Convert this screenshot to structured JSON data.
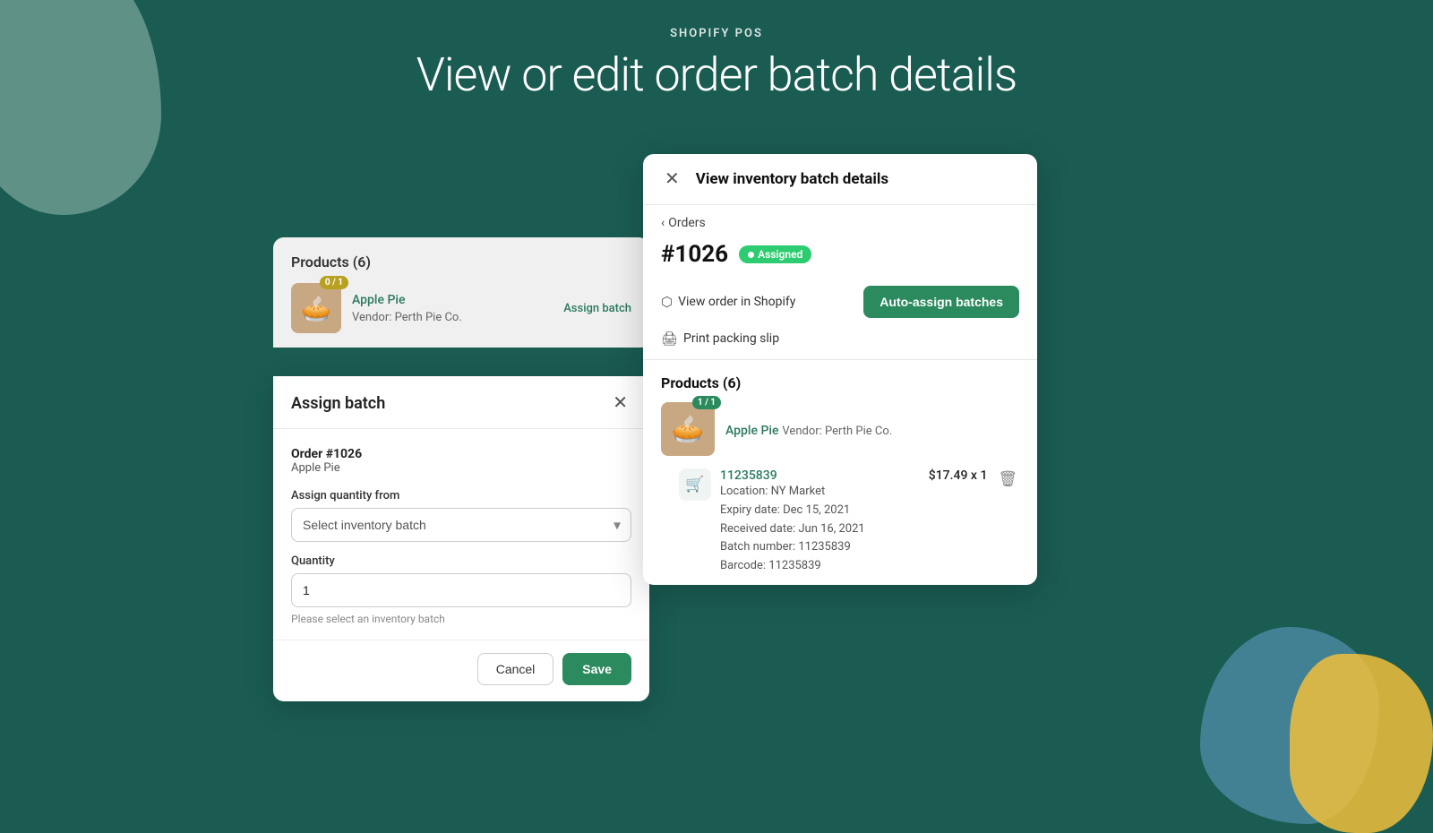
{
  "app": {
    "subtitle": "SHOPIFY POS",
    "title": "View or edit order batch details"
  },
  "products_panel": {
    "header": "Products (6)",
    "product": {
      "badge": "0 / 1",
      "name": "Apple Pie",
      "vendor": "Vendor: Perth Pie Co.",
      "assign_label": "Assign batch"
    }
  },
  "assign_modal": {
    "title": "Assign batch",
    "order_label": "Order #1026",
    "order_product": "Apple Pie",
    "assign_qty_label": "Assign quantity from",
    "select_placeholder": "Select inventory batch",
    "qty_label": "Quantity",
    "qty_value": "1",
    "hint": "Please select an inventory batch",
    "cancel_label": "Cancel",
    "save_label": "Save"
  },
  "inventory_panel": {
    "title": "View inventory batch details",
    "back_label": "Orders",
    "order_number": "#1026",
    "status": "Assigned",
    "view_order_label": "View order in Shopify",
    "auto_assign_label": "Auto-assign batches",
    "print_label": "Print packing slip",
    "products_header": "Products (6)",
    "product": {
      "badge": "1 / 1",
      "name": "Apple Pie",
      "vendor": "Vendor: Perth Pie Co."
    },
    "batch": {
      "id": "11235839",
      "price": "$17.49 x 1",
      "location": "Location: NY Market",
      "expiry": "Expiry date: Dec 15, 2021",
      "received": "Received date: Jun 16, 2021",
      "batch_number": "Batch number: 11235839",
      "barcode": "Barcode: 11235839"
    }
  },
  "icons": {
    "close": "✕",
    "chevron_left": "‹",
    "chevron_down": "⌄",
    "shopify_view": "↗",
    "printer": "🖨",
    "cart": "🛒",
    "trash": "🗑"
  }
}
